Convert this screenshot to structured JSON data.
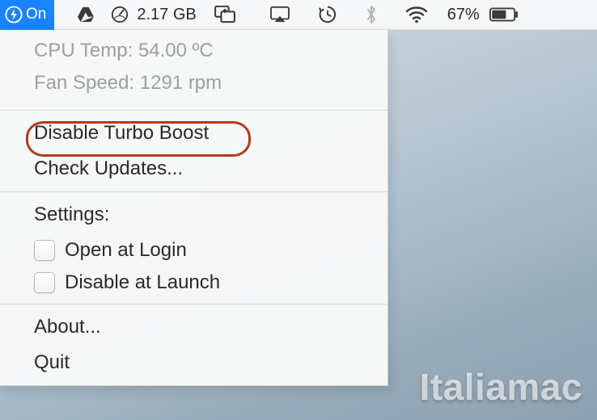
{
  "menubar": {
    "turbo_state": "On",
    "drive_usage": "2.17 GB",
    "battery_percent": "67%"
  },
  "dropdown": {
    "cpu_temp_line": "CPU Temp: 54.00 ºC",
    "fan_speed_line": "Fan Speed: 1291 rpm",
    "disable_turbo": "Disable Turbo Boost",
    "check_updates": "Check Updates...",
    "settings_heading": "Settings:",
    "open_at_login": "Open at Login",
    "disable_at_launch": "Disable at Launch",
    "about": "About...",
    "quit": "Quit"
  },
  "watermark": "Italiamac"
}
